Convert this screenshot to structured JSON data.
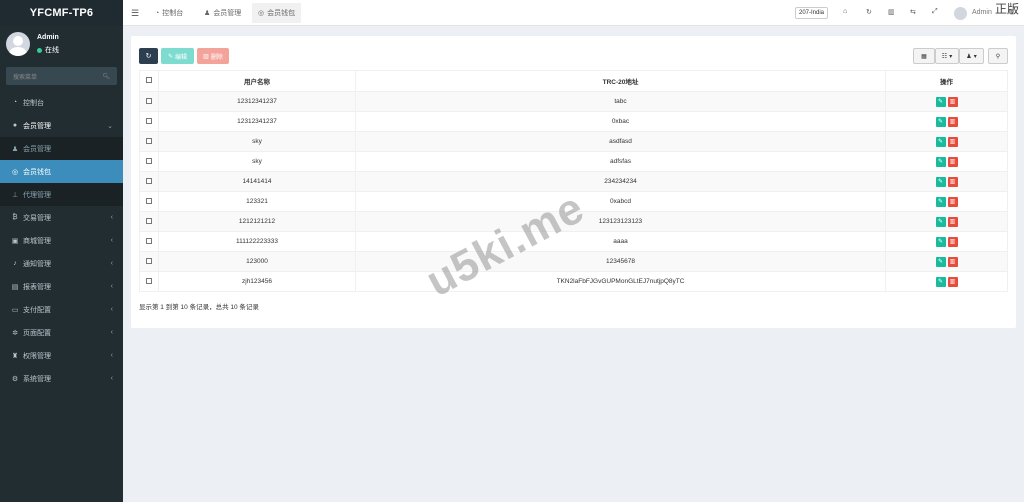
{
  "sidebar": {
    "logo": "YFCMF-TP6",
    "user": {
      "name": "Admin",
      "status": "在线"
    },
    "search_placeholder": "搜索菜单",
    "items": [
      {
        "label": "控制台",
        "icon": "dashboard-icon"
      },
      {
        "label": "会员管理",
        "icon": "users-icon",
        "arrow": "⌄"
      },
      {
        "label": "会员管理",
        "icon": "user-icon"
      },
      {
        "label": "会员钱包",
        "icon": "wallet-icon"
      },
      {
        "label": "代理管理",
        "icon": "sitemap-icon"
      },
      {
        "label": "交易管理",
        "icon": "bitcoin-icon",
        "arrow": "‹"
      },
      {
        "label": "商城管理",
        "icon": "shop-icon",
        "arrow": "‹"
      },
      {
        "label": "通知管理",
        "icon": "bell-icon",
        "arrow": "‹"
      },
      {
        "label": "报表管理",
        "icon": "chart-icon",
        "arrow": "‹"
      },
      {
        "label": "支付配置",
        "icon": "credit-card-icon",
        "arrow": "‹"
      },
      {
        "label": "页面配置",
        "icon": "gear-icon",
        "arrow": "‹"
      },
      {
        "label": "权限管理",
        "icon": "user-lock-icon",
        "arrow": "‹"
      },
      {
        "label": "系统管理",
        "icon": "cogs-icon",
        "arrow": "‹"
      }
    ]
  },
  "navbar": {
    "tabs": [
      {
        "label": "控制台",
        "icon": "dashboard-icon"
      },
      {
        "label": "会员管理",
        "icon": "user-icon"
      },
      {
        "label": "会员钱包",
        "icon": "wallet-icon"
      }
    ],
    "lang": "207-India",
    "admin_name": "Admin",
    "corner_text": "正版"
  },
  "toolbar": {
    "edit_label": "编辑",
    "delete_label": "删除"
  },
  "table": {
    "headers": [
      "用户名称",
      "TRC-20地址",
      "操作"
    ],
    "rows": [
      {
        "username": "12312341237",
        "address": "tabc"
      },
      {
        "username": "12312341237",
        "address": "0xbac"
      },
      {
        "username": "sky",
        "address": "asdfasd"
      },
      {
        "username": "sky",
        "address": "adfsfas"
      },
      {
        "username": "14141414",
        "address": "234234234"
      },
      {
        "username": "123321",
        "address": "0xabcd"
      },
      {
        "username": "1212121212",
        "address": "123123123123"
      },
      {
        "username": "111122223333",
        "address": "aaaa"
      },
      {
        "username": "123000",
        "address": "12345678"
      },
      {
        "username": "zjh123456",
        "address": "TKN2laFbFJGvGUPMonGLtEJ7nutjpQ8yTC"
      }
    ]
  },
  "pager_text": "显示第 1 到第 10 条记录，总共 10 条记录",
  "watermark": "u5ki.me"
}
